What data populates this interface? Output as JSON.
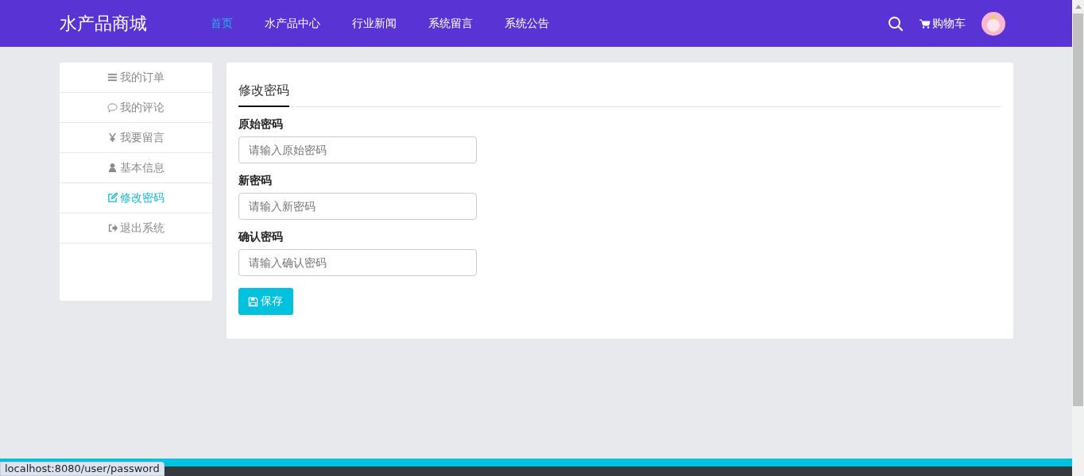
{
  "header": {
    "logo": "水产品商城",
    "nav": [
      {
        "label": "首页",
        "selected": true
      },
      {
        "label": "水产品中心",
        "selected": false
      },
      {
        "label": "行业新闻",
        "selected": false
      },
      {
        "label": "系统留言",
        "selected": false
      },
      {
        "label": "系统公告",
        "selected": false
      }
    ],
    "cart": "购物车"
  },
  "sidebar": {
    "items": [
      {
        "label": "我的订单",
        "kind": "list",
        "selected": false
      },
      {
        "label": "我的评论",
        "kind": "comment",
        "selected": false
      },
      {
        "label": "我要留言",
        "kind": "yen",
        "selected": false
      },
      {
        "label": "基本信息",
        "kind": "user",
        "selected": false
      },
      {
        "label": "修改密码",
        "kind": "edit",
        "selected": true
      },
      {
        "label": "退出系统",
        "kind": "signout",
        "selected": false
      }
    ]
  },
  "form": {
    "title": "修改密码",
    "fields": [
      {
        "label": "原始密码",
        "placeholder": "请输入原始密码"
      },
      {
        "label": "新密码",
        "placeholder": "请输入新密码"
      },
      {
        "label": "确认密码",
        "placeholder": "请输入确认密码"
      }
    ],
    "save_button": "保存"
  },
  "status_bar": "localhost:8080/user/password"
}
